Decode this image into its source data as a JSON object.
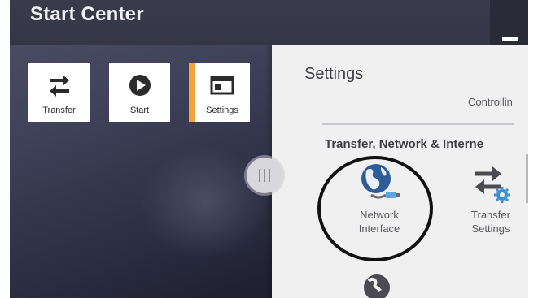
{
  "app": {
    "title": "Start Center"
  },
  "launcher": {
    "tiles": [
      {
        "label": "Transfer",
        "icon": "transfer-arrows-icon"
      },
      {
        "label": "Start",
        "icon": "play-circle-icon"
      },
      {
        "label": "Settings",
        "icon": "settings-window-icon",
        "active": true
      }
    ]
  },
  "settings_panel": {
    "title": "Settings",
    "partial_category": "Controllin",
    "section_heading": "Transfer, Network & Interne",
    "items": [
      {
        "label_line1": "Network",
        "label_line2": "Interface",
        "icon": "globe-network-icon"
      },
      {
        "label_line1": "Transfer",
        "label_line2": "Settings",
        "icon": "transfer-settings-icon"
      }
    ]
  },
  "colors": {
    "accent": "#f3a33a",
    "title_bar": "#363746",
    "panel_bg": "#f0f0f0",
    "globe_blue": "#2e5c98",
    "gear_blue": "#3a8fd8"
  }
}
